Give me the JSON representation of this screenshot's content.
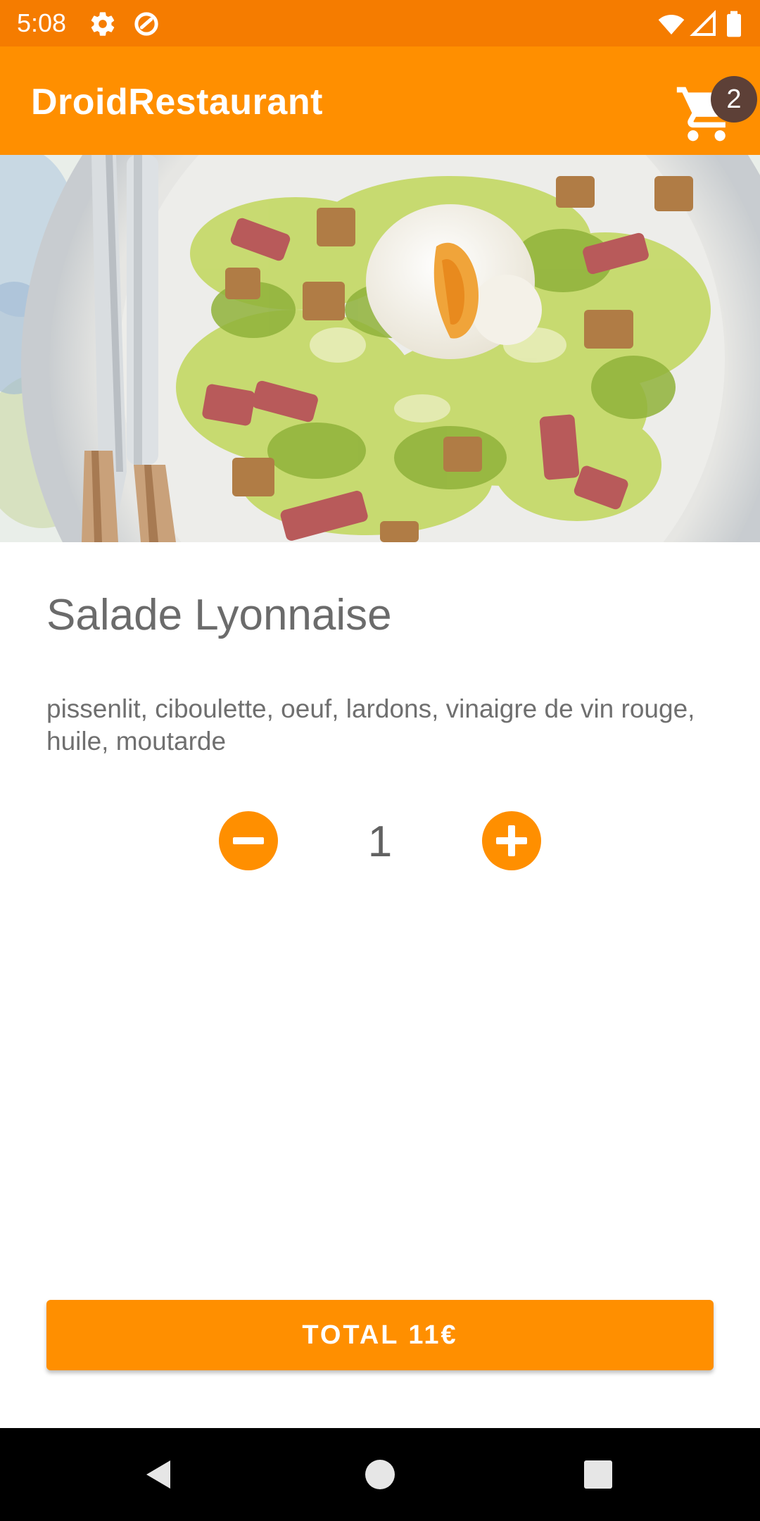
{
  "status_bar": {
    "time": "5:08",
    "left_icons": [
      "settings-icon",
      "data-saver-icon"
    ],
    "right_icons": [
      "wifi-icon",
      "cell-signal-icon",
      "battery-icon"
    ]
  },
  "app_bar": {
    "title": "DroidRestaurant",
    "cart_badge_count": "2"
  },
  "dish": {
    "name": "Salade Lyonnaise",
    "ingredients": "pissenlit, ciboulette, oeuf, lardons, vinaigre de vin rouge, huile, moutarde",
    "image": "salad-photo"
  },
  "quantity": {
    "value": "1"
  },
  "total_button": {
    "label": "TOTAL 11€"
  },
  "nav_bar": {
    "buttons": [
      "back-icon",
      "home-icon",
      "recents-icon"
    ]
  },
  "colors": {
    "status_bar": "#f57c00",
    "primary": "#ff8f00",
    "badge": "#5d4037",
    "text_gray": "#6b6b6b"
  }
}
